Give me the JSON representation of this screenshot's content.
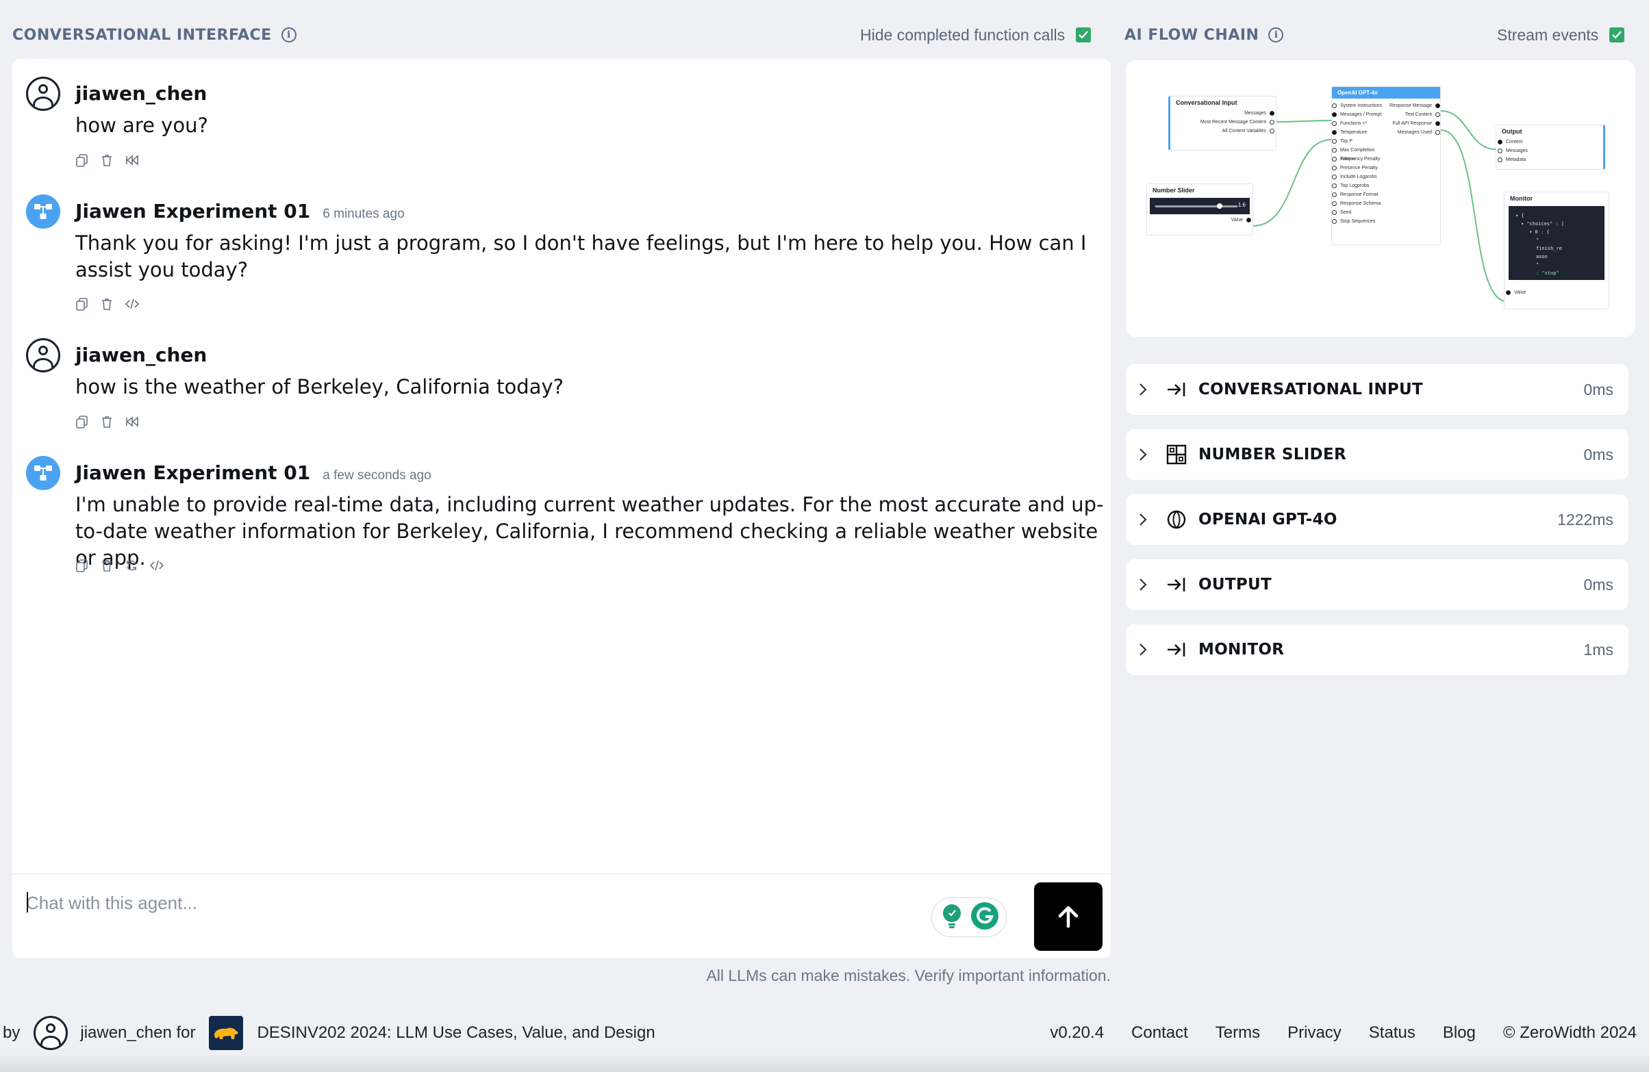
{
  "left_panel": {
    "title": "CONVERSATIONAL INTERFACE",
    "toggle_label": "Hide completed function calls"
  },
  "messages": [
    {
      "author": "jiawen_chen",
      "time": "",
      "text": "how are you?",
      "role": "user"
    },
    {
      "author": "Jiawen Experiment 01",
      "time": "6 minutes ago",
      "text": "Thank you for asking! I'm just a program, so I don't have feelings, but I'm here to help you. How can I assist you today?",
      "role": "agent"
    },
    {
      "author": "jiawen_chen",
      "time": "",
      "text": "how is the weather of Berkeley, California today?",
      "role": "user"
    },
    {
      "author": "Jiawen Experiment 01",
      "time": "a few seconds ago",
      "text": "I'm unable to provide real-time data, including current weather updates. For the most accurate and up-to-date weather information for Berkeley, California, I recommend checking a reliable weather website or app.",
      "role": "agent"
    }
  ],
  "chat_input": {
    "placeholder": "Chat with this agent...",
    "value": ""
  },
  "disclaimer": "All LLMs can make mistakes. Verify important information.",
  "right_panel": {
    "title": "AI FLOW CHAIN",
    "toggle_label": "Stream events"
  },
  "flow_diagram": {
    "conversational_input": {
      "title": "Conversational Input",
      "ports": [
        "Messages",
        "Most Recent Message Content",
        "All Context Variables"
      ]
    },
    "number_slider": {
      "title": "Number Slider",
      "value": "1.6",
      "port": "Value"
    },
    "openai": {
      "title": "OpenAI GPT-4o",
      "inputs": [
        "System Instructions",
        "Messages / Prompt",
        "Functions +*",
        "Temperature",
        "Top P",
        "Max Completion Tokens",
        "Frequency Penalty",
        "Presence Penalty",
        "Include Logprobs",
        "Top Logprobs",
        "Response Format",
        "Response Schema",
        "Seed",
        "Stop Sequences"
      ],
      "outputs": [
        "Response Message",
        "Text Content",
        "Full API Response",
        "Messages Used"
      ]
    },
    "output": {
      "title": "Output",
      "ports": [
        "Content",
        "Messages",
        "Metadata"
      ]
    },
    "monitor": {
      "title": "Monitor",
      "code": [
        "▾ {",
        "▾ \"choices\" : [",
        "▾ 0 : {",
        "\"",
        "finish_re",
        "ason",
        "\"",
        ": \"stop\""
      ],
      "port": "Value"
    }
  },
  "steps": [
    {
      "label": "CONVERSATIONAL INPUT",
      "time": "0ms",
      "icon": "arrow-into-bar-icon"
    },
    {
      "label": "NUMBER SLIDER",
      "time": "0ms",
      "icon": "grid-icon"
    },
    {
      "label": "OPENAI GPT-4O",
      "time": "1222ms",
      "icon": "openai-logo-icon"
    },
    {
      "label": "OUTPUT",
      "time": "0ms",
      "icon": "arrow-into-bar-icon"
    },
    {
      "label": "MONITOR",
      "time": "1ms",
      "icon": "arrow-into-bar-icon"
    }
  ],
  "footer": {
    "by": "by",
    "user": "jiawen_chen for",
    "project": "DESINV202 2024: LLM Use Cases, Value, and Design",
    "version": "v0.20.4",
    "links": [
      "Contact",
      "Terms",
      "Privacy",
      "Status",
      "Blog"
    ],
    "copyright": "© ZeroWidth 2024"
  },
  "colors": {
    "accent": "#2fa86a",
    "agent_avatar": "#4aa3f0",
    "title_gray": "#5b6b86",
    "flow_line": "#6cc08a"
  }
}
